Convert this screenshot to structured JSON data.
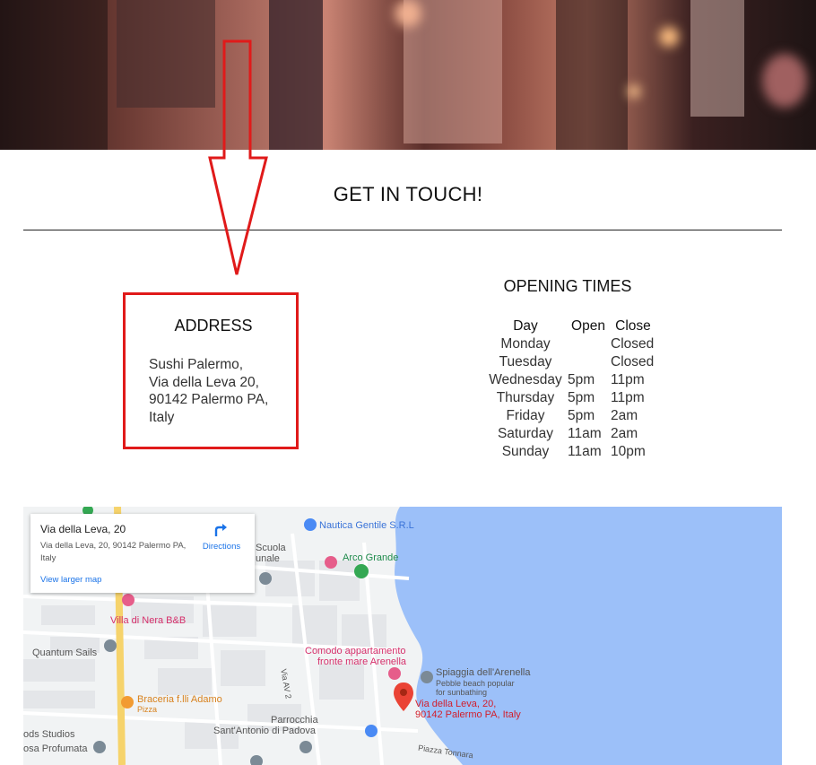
{
  "section_title": "GET IN TOUCH!",
  "address": {
    "heading": "ADDRESS",
    "lines": [
      "Sushi Palermo,",
      "Via della Leva 20,",
      "90142 Palermo PA,",
      "Italy"
    ]
  },
  "opening_times": {
    "heading": "OPENING TIMES",
    "columns": [
      "Day",
      "Open",
      "Close"
    ],
    "rows": [
      {
        "day": "Monday",
        "open": "",
        "close": "Closed"
      },
      {
        "day": "Tuesday",
        "open": "",
        "close": "Closed"
      },
      {
        "day": "Wednesday",
        "open": "5pm",
        "close": "11pm"
      },
      {
        "day": "Thursday",
        "open": "5pm",
        "close": "11pm"
      },
      {
        "day": "Friday",
        "open": "5pm",
        "close": "2am"
      },
      {
        "day": "Saturday",
        "open": "11am",
        "close": "2am"
      },
      {
        "day": "Sunday",
        "open": "11am",
        "close": "10pm"
      }
    ]
  },
  "map": {
    "card": {
      "title": "Via della Leva, 20",
      "address": "Via della Leva, 20, 90142 Palermo PA, Italy",
      "directions": "Directions",
      "larger_map": "View larger map"
    },
    "labels": {
      "nautica": "Nautica Gentile S.R.L",
      "scuola1": "Scuola",
      "scuola2": "unale",
      "arco": "Arco Grande",
      "villa": "Villa di Nera B&B",
      "quantum": "Quantum Sails",
      "comodo1": "Comodo appartamento",
      "comodo2": "fronte mare Arenella",
      "spiaggia": "Spiaggia dell'Arenella",
      "pebble1": "Pebble beach popular",
      "pebble2": "for sunbathing",
      "via_av2": "Via AV 2",
      "braceria": "Braceria f.lli Adamo",
      "pizza": "Pizza",
      "location1": "Via della Leva, 20,",
      "location2": "90142 Palermo PA, Italy",
      "parrocchia1": "Parrocchia",
      "parrocchia2": "Sant'Antonio di Padova",
      "ods": "ods Studios",
      "osa": "osa Profumata",
      "piazza": "Piazza Tonnara"
    }
  },
  "colors": {
    "annotation_red": "#e01a1a",
    "water": "#9cc0f9",
    "map_land": "#f1f3f4",
    "road_yellow": "#f6d36b",
    "link_blue": "#1a73e8"
  }
}
